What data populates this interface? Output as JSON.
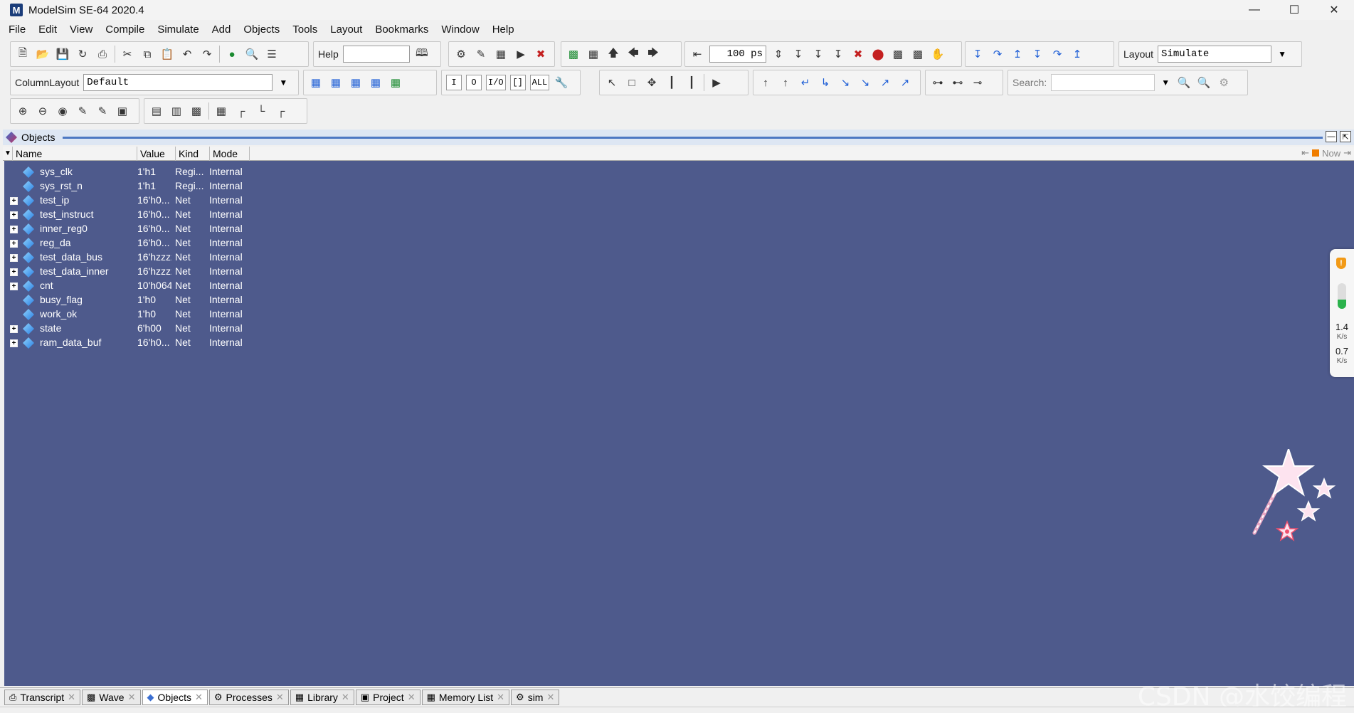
{
  "window": {
    "title": "ModelSim SE-64 2020.4",
    "logo": "M"
  },
  "menu": [
    "File",
    "Edit",
    "View",
    "Compile",
    "Simulate",
    "Add",
    "Objects",
    "Tools",
    "Layout",
    "Bookmarks",
    "Window",
    "Help"
  ],
  "toolbar": {
    "help_label": "Help",
    "help_value": "",
    "run_length": "100 ps",
    "layout_label": "Layout",
    "layout_value": "Simulate",
    "column_layout_label": "ColumnLayout",
    "column_layout_value": "Default",
    "search_label": "Search:",
    "search_value": "",
    "filter_buttons": [
      "I",
      "O",
      "I/O",
      "[]",
      "ALL"
    ]
  },
  "objects": {
    "title": "Objects",
    "columns": {
      "name": "Name",
      "value": "Value",
      "kind": "Kind",
      "mode": "Mode"
    },
    "now_label": "Now",
    "rows": [
      {
        "name": "sys_clk",
        "value": "1'h1",
        "kind": "Regi...",
        "mode": "Internal",
        "expandable": false
      },
      {
        "name": "sys_rst_n",
        "value": "1'h1",
        "kind": "Regi...",
        "mode": "Internal",
        "expandable": false
      },
      {
        "name": "test_ip",
        "value": "16'h0...",
        "kind": "Net",
        "mode": "Internal",
        "expandable": true
      },
      {
        "name": "test_instruct",
        "value": "16'h0...",
        "kind": "Net",
        "mode": "Internal",
        "expandable": true
      },
      {
        "name": "inner_reg0",
        "value": "16'h0...",
        "kind": "Net",
        "mode": "Internal",
        "expandable": true
      },
      {
        "name": "reg_da",
        "value": "16'h0...",
        "kind": "Net",
        "mode": "Internal",
        "expandable": true
      },
      {
        "name": "test_data_bus",
        "value": "16'hzzzz",
        "kind": "Net",
        "mode": "Internal",
        "expandable": true
      },
      {
        "name": "test_data_inner",
        "value": "16'hzzzz",
        "kind": "Net",
        "mode": "Internal",
        "expandable": true
      },
      {
        "name": "cnt",
        "value": "10'h064",
        "kind": "Net",
        "mode": "Internal",
        "expandable": true
      },
      {
        "name": "busy_flag",
        "value": "1'h0",
        "kind": "Net",
        "mode": "Internal",
        "expandable": false
      },
      {
        "name": "work_ok",
        "value": "1'h0",
        "kind": "Net",
        "mode": "Internal",
        "expandable": false
      },
      {
        "name": "state",
        "value": "6'h00",
        "kind": "Net",
        "mode": "Internal",
        "expandable": true
      },
      {
        "name": "ram_data_buf",
        "value": "16'h0...",
        "kind": "Net",
        "mode": "Internal",
        "expandable": true
      }
    ]
  },
  "net_widget": {
    "badge": "!",
    "up": "1.4",
    "up_unit": "K/s",
    "down": "0.7",
    "down_unit": "K/s",
    "level": 0.35
  },
  "tabs": [
    {
      "label": "Transcript",
      "icon": "transcript-icon",
      "active": false
    },
    {
      "label": "Wave",
      "icon": "wave-icon",
      "active": false
    },
    {
      "label": "Objects",
      "icon": "objects-icon",
      "active": true
    },
    {
      "label": "Processes",
      "icon": "processes-icon",
      "active": false
    },
    {
      "label": "Library",
      "icon": "library-icon",
      "active": false
    },
    {
      "label": "Project",
      "icon": "project-icon",
      "active": false
    },
    {
      "label": "Memory List",
      "icon": "memory-icon",
      "active": false
    },
    {
      "label": "sim",
      "icon": "sim-icon",
      "active": false
    }
  ],
  "watermark": "CSDN @水饺编程",
  "colors": {
    "pane_bg": "#4e5a8c",
    "header_bg": "#dde6f3",
    "accent": "#4d78c2"
  }
}
